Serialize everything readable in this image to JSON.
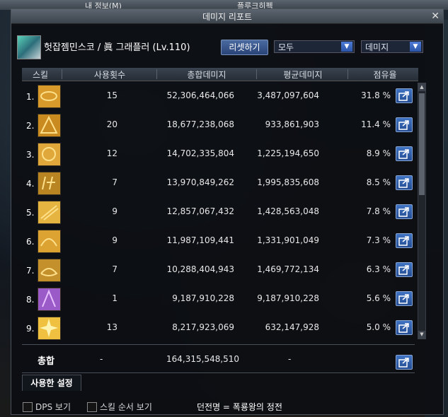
{
  "background": {
    "title_left": "내 정보(M)",
    "title_right": "플루크히펙"
  },
  "window": {
    "title": "데미지 리포트",
    "close_icon": "close-icon"
  },
  "character": {
    "name": "헛잡젬민스코 / 眞 그래플러 (Lv.110)"
  },
  "controls": {
    "reset_label": "리셋하기",
    "filter_select": "모두",
    "metric_select": "데미지"
  },
  "columns": [
    "스킬",
    "사용횟수",
    "총합데미지",
    "평균데미지",
    "점유율"
  ],
  "rows": [
    {
      "rank": "1.",
      "uses": "15",
      "total": "52,306,464,066",
      "avg": "3,487,097,604",
      "share": "31.8 %",
      "color": "#d89a2a"
    },
    {
      "rank": "2.",
      "uses": "20",
      "total": "18,677,238,068",
      "avg": "933,861,903",
      "share": "11.4 %",
      "color": "#c98a20"
    },
    {
      "rank": "3.",
      "uses": "12",
      "total": "14,702,335,804",
      "avg": "1,225,194,650",
      "share": "8.9 %",
      "color": "#e0a83a"
    },
    {
      "rank": "4.",
      "uses": "7",
      "total": "13,970,849,262",
      "avg": "1,995,835,608",
      "share": "8.5 %",
      "color": "#b88522"
    },
    {
      "rank": "5.",
      "uses": "9",
      "total": "12,857,067,432",
      "avg": "1,428,563,048",
      "share": "7.8 %",
      "color": "#e6b440"
    },
    {
      "rank": "6.",
      "uses": "9",
      "total": "11,987,109,441",
      "avg": "1,331,901,049",
      "share": "7.3 %",
      "color": "#dca232"
    },
    {
      "rank": "7.",
      "uses": "7",
      "total": "10,288,404,943",
      "avg": "1,469,772,134",
      "share": "6.3 %",
      "color": "#c4902c"
    },
    {
      "rank": "8.",
      "uses": "1",
      "total": "9,187,910,228",
      "avg": "9,187,910,228",
      "share": "5.6 %",
      "color": "#9a5ac8"
    },
    {
      "rank": "9.",
      "uses": "13",
      "total": "8,217,923,069",
      "avg": "632,147,928",
      "share": "5.0 %",
      "color": "#f0c040"
    }
  ],
  "total": {
    "label": "총합",
    "uses": "-",
    "total": "164,315,548,510",
    "avg": "-"
  },
  "tabs": {
    "settings": "사용한 설정"
  },
  "footer": {
    "dps_label": "DPS 보기",
    "order_label": "스킬 순서 보기",
    "dungeon_text": "던전명 = 폭룡왕의 정전"
  }
}
